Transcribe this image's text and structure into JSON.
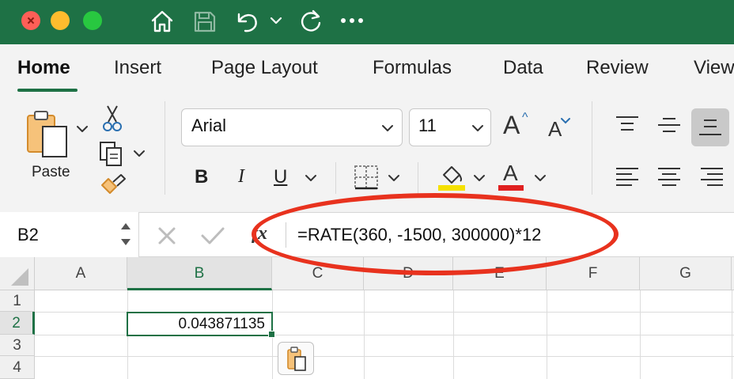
{
  "title_bar": {
    "icons": [
      "home-icon",
      "save-icon",
      "undo-icon",
      "undo-dropdown-icon",
      "redo-icon",
      "more-icon"
    ]
  },
  "ribbon": {
    "tabs": [
      "Home",
      "Insert",
      "Page Layout",
      "Formulas",
      "Data",
      "Review",
      "View"
    ],
    "active_tab": "Home",
    "paste_label": "Paste",
    "font_name": "Arial",
    "font_size": "11",
    "bold": "B",
    "italic": "I",
    "underline": "U",
    "increase_font": "A",
    "decrease_font": "A",
    "font_color_glyph": "A",
    "highlight_color": "#f5e100",
    "font_color": "#e02020"
  },
  "formula_bar": {
    "name_box": "B2",
    "fx_label": "fx",
    "formula": "=RATE(360, -1500, 300000)*12"
  },
  "grid": {
    "columns": [
      "A",
      "B",
      "C",
      "D",
      "E",
      "F",
      "G"
    ],
    "rows": [
      "1",
      "2",
      "3",
      "4"
    ],
    "selected_cell": "B2",
    "cell_value": "0.043871135"
  },
  "colors": {
    "accent": "#1e7145",
    "annotation": "#e8321e"
  }
}
